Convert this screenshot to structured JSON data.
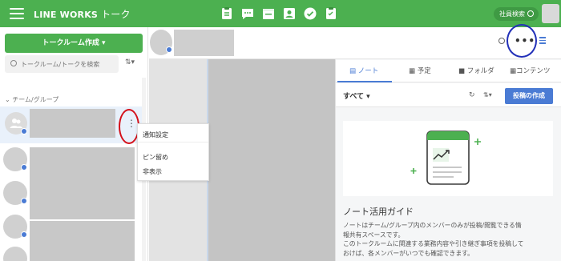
{
  "app": {
    "brand": "LINE WORKS",
    "section": "トーク"
  },
  "top_bar": {
    "icons": [
      "note-icon",
      "talk-icon",
      "calendar-icon",
      "contacts-icon",
      "check-icon",
      "form-icon"
    ],
    "search_label": "社員検索",
    "accent": "#4cb050"
  },
  "sidebar": {
    "create_label": "トークルーム作成",
    "search_placeholder": "トークルーム/トークを検索",
    "group_header": "チーム/グループ"
  },
  "context_menu": {
    "items": [
      "通知設定",
      "ピン留め",
      "非表示"
    ]
  },
  "right_panel": {
    "tabs": [
      {
        "label": "ノート",
        "icon": "note-icon"
      },
      {
        "label": "予定",
        "icon": "calendar-icon"
      },
      {
        "label": "フォルダ",
        "icon": "folder-icon"
      },
      {
        "label": "コンテンツ",
        "icon": "grid-icon"
      }
    ],
    "filter_label": "すべて",
    "post_label": "投稿の作成",
    "guide_title": "ノート活用ガイド",
    "guide_lines": [
      "ノートはチーム/グループ内のメンバーのみが投稿/閲覧できる情",
      "報共有スペースです。",
      "このトークルームに関連する業務内容や引き継ぎ事項を投稿して",
      "おけば、各メンバーがいつでも確認できます。"
    ],
    "link_color": "#4a7bd4"
  }
}
